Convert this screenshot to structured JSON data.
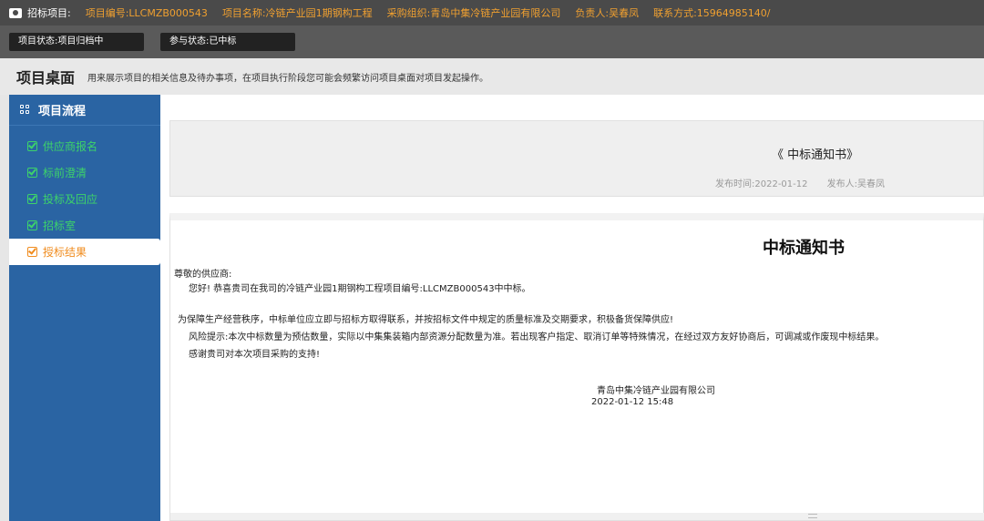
{
  "topbar": {
    "icon": "camera-icon",
    "label": "招标项目:",
    "project_no": "项目编号:LLCMZB000543",
    "project_name": "项目名称:冷链产业园1期钢构工程",
    "org": "采购组织:青岛中集冷链产业园有限公司",
    "owner": "负责人:吴春凤",
    "contact": "联系方式:15964985140/"
  },
  "status": {
    "project_status": "项目状态:项目归档中",
    "participation_status": "参与状态:已中标"
  },
  "header": {
    "title": "项目桌面",
    "description": "用来展示项目的相关信息及待办事项，在项目执行阶段您可能会频繁访问项目桌面对项目发起操作。"
  },
  "sidebar": {
    "heading": "项目流程",
    "items": [
      {
        "label": "供应商报名",
        "active": false
      },
      {
        "label": "标前澄清",
        "active": false
      },
      {
        "label": "投标及回应",
        "active": false
      },
      {
        "label": "招标室",
        "active": false
      },
      {
        "label": "授标结果",
        "active": true
      }
    ]
  },
  "notice": {
    "title": "《 中标通知书》",
    "publish_time": "发布时间:2022-01-12",
    "publisher": "发布人:吴春凤"
  },
  "document": {
    "title": "中标通知书",
    "greeting": "尊敬的供应商:",
    "line1": "您好! 恭喜贵司在我司的冷链产业园1期钢构工程项目编号:LLCMZB000543中中标。",
    "line2": "为保障生产经营秩序，中标单位应立即与招标方取得联系，并按招标文件中规定的质量标准及交期要求，积极备货保障供应!",
    "line3": "风险提示:本次中标数量为预估数量，实际以中集集装箱内部资源分配数量为准。若出现客户指定、取消订单等特殊情况，在经过双方友好协商后，可调减或作废现中标结果。",
    "line4": "感谢贵司对本次项目采购的支持!",
    "signature_org": "青岛中集冷链产业园有限公司",
    "signature_date": "2022-01-12 15:48"
  },
  "colors": {
    "sidebar_bg": "#2a64a3",
    "done_green": "#3dd36a",
    "active_orange": "#f08c1e",
    "topbar_text": "#f0a030"
  }
}
